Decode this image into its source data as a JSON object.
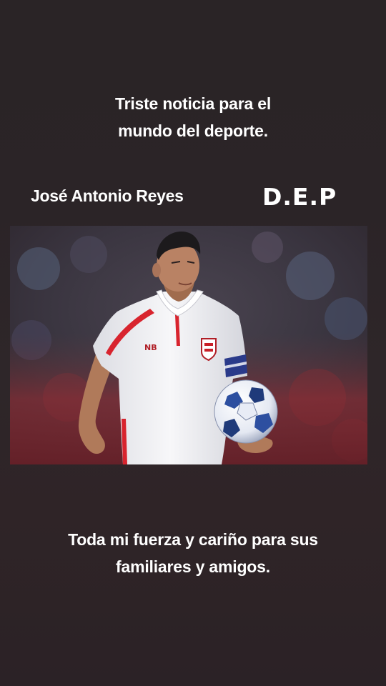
{
  "story": {
    "headline": "Triste noticia para el\nmundo del deporte.",
    "player_name": "José Antonio Reyes",
    "dep_label": "D.E.P",
    "photo": {
      "subject": "football-player-photo",
      "colors": {
        "jersey": "#f4f4f6",
        "jersey_stripe": "#d8242e",
        "captain_band": "#2a3a8a",
        "background_crowd": "#7a2e36"
      }
    },
    "footer": "Toda mi fuerza y cariño para sus\nfamiliares y amigos."
  }
}
